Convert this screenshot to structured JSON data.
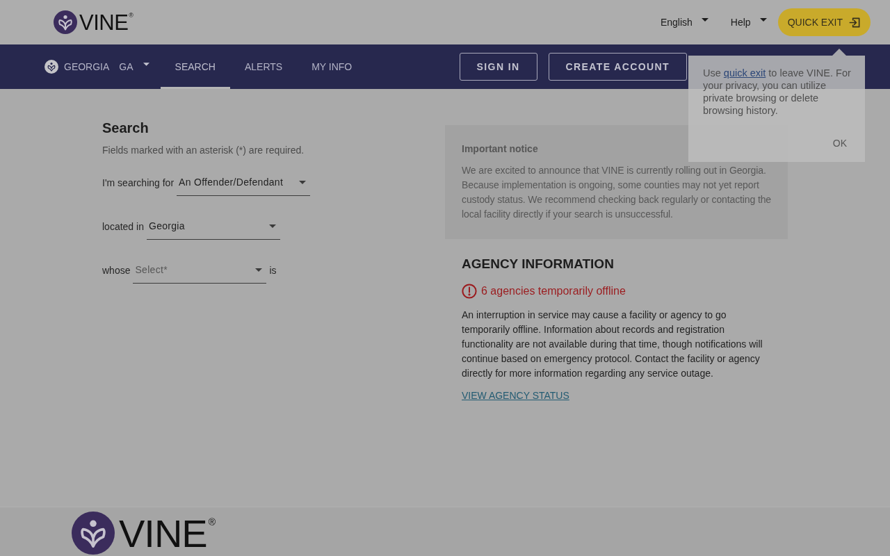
{
  "header": {
    "logo": "VINE$^{®}$",
    "menus": [
      {
        "label": "English"
      },
      {
        "label": "Help"
      }
    ],
    "quick_exit": "QUICK EXIT"
  },
  "nav": {
    "state_name": "GEORGIA",
    "state_code": "GA",
    "tabs": [
      {
        "label": "SEARCH",
        "selected": true
      },
      {
        "label": "ALERTS",
        "selected": false
      },
      {
        "label": "MY INFO",
        "selected": false
      }
    ],
    "buttons": [
      "SIGN IN",
      "CREATE ACCOUNT"
    ]
  },
  "popover": {
    "text_before": "Use ",
    "link": "quick exit",
    "text_after": " to leave VINE. For your privacy, you can utilize private browsing or delete browsing history.",
    "button": "OK"
  },
  "search": {
    "title": "Search",
    "hint": "Fields marked with an asterisk (*) are required.",
    "rows": [
      {
        "label": "I'm searching for",
        "value": "An Offender/Defendant"
      },
      {
        "label": "located in",
        "value": "Georgia"
      },
      {
        "label": "whose",
        "placeholder": "Select*",
        "suffix": "is"
      }
    ]
  },
  "notice": {
    "title": "Important notice",
    "text": "We are excited to announce that VINE is currently rolling out in Georgia. Because implementation is ongoing, some counties may not yet report custody status. We recommend checking back regularly or contacting the local facility directly if your search is unsuccessful."
  },
  "agency": {
    "title": "AGENCY INFORMATION",
    "alert": "6 agencies temporarily offline",
    "text": "An interruption in service may cause a facility or agency to go temporarily offline. Information about records and registration functionality are not available during that time, though notifications will continue based on emergency protocol. Contact the facility or agency directly for more information regarding any service outage.",
    "link": "VIEW AGENCY STATUS"
  },
  "footer": {
    "logo": "VINE$^{®}$"
  }
}
